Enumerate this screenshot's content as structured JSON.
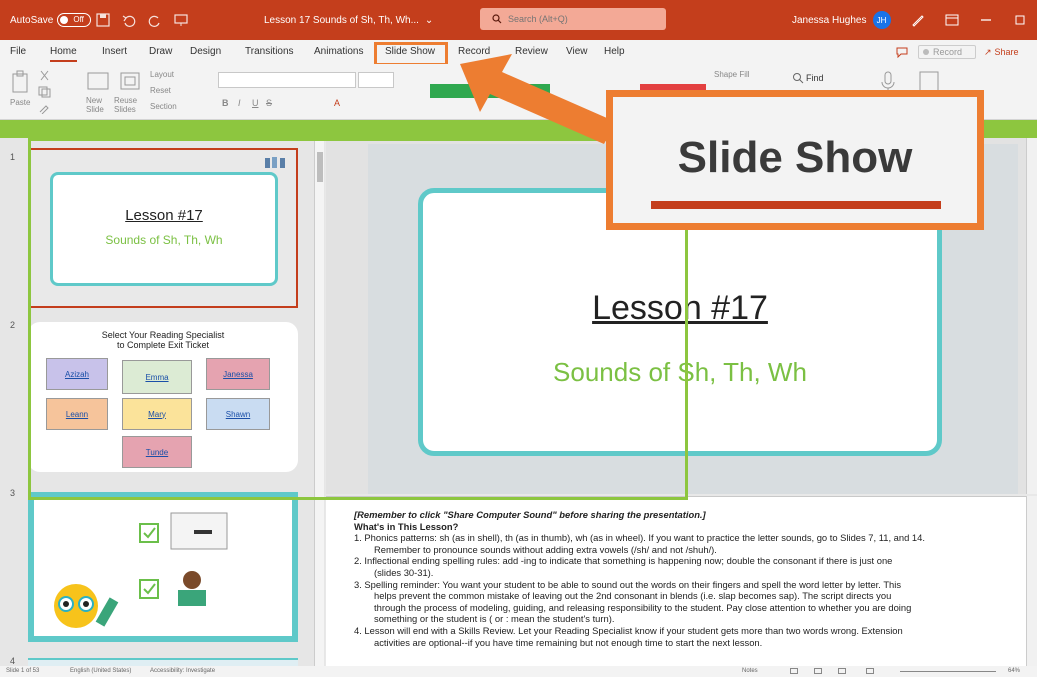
{
  "titlebar": {
    "autosave_label": "AutoSave",
    "autosave_state": "Off",
    "doc_title": "Lesson 17 Sounds of Sh, Th, Wh...",
    "search_placeholder": "Search (Alt+Q)",
    "user_name": "Janessa Hughes",
    "user_initials": "JH"
  },
  "menu": {
    "tabs": [
      "File",
      "Home",
      "Insert",
      "Draw",
      "Design",
      "Transitions",
      "Animations",
      "Slide Show",
      "Record",
      "Review",
      "View",
      "Help"
    ],
    "active_tab": "Home",
    "highlighted_tab": "Slide Show",
    "record_label": "Record",
    "share_label": "Share"
  },
  "ribbon": {
    "paste_label": "Paste",
    "new_slide_label": "New Slide",
    "reuse_slides_label": "Reuse Slides",
    "layout_label": "Layout",
    "reset_label": "Reset",
    "section_label": "Section",
    "find_label": "Find",
    "shape_fill_label": "Shape Fill"
  },
  "thumbnails": {
    "numbers": [
      "1",
      "2",
      "3",
      "4"
    ],
    "slide1_title": "Lesson #17",
    "slide1_subtitle": "Sounds of Sh, Th, Wh",
    "slide2_heading_line1": "Select Your Reading Specialist",
    "slide2_heading_line2": "to Complete Exit Ticket",
    "slide2_names": [
      "Azizah",
      "Emma",
      "Janessa",
      "Leann",
      "Mary",
      "Shawn",
      "Tunde"
    ]
  },
  "slide": {
    "title": "Lesson #17",
    "subtitle": "Sounds of Sh, Th, Wh"
  },
  "notes": {
    "line0": "[Remember to click \"Share Computer Sound\" before sharing the presentation.]",
    "line1": "What's in This Lesson?",
    "item1": "1. Phonics patterns: sh (as in shell), th (as in thumb), wh (as in wheel). If you want to practice the letter sounds, go to Slides 7, 11, and 14.",
    "item1b": "Remember to pronounce sounds without adding extra vowels (/sh/ and not /shuh/).",
    "item2": "2. Inflectional ending spelling rules: add -ing to indicate that something is happening now; double the consonant if there is just one",
    "item2b": "(slides 30-31).",
    "item3": "3. Spelling reminder: You want your student to be able to sound out the words on their fingers and spell the word letter by letter. This",
    "item3b": "helps prevent the common mistake of leaving out the 2nd consonant in blends (i.e. slap becomes sap). The script directs you",
    "item3c": "through the process of modeling, guiding, and releasing responsibility to the student. Pay close attention to whether you are doing",
    "item3d": "something or the student is (  or  : mean the student's turn).",
    "item4": "4. Lesson will end with a Skills Review. Let your Reading Specialist know if your student gets more than two words wrong. Extension",
    "item4b": "activities are optional--if you have time remaining but not enough time to start the next lesson."
  },
  "statusbar": {
    "slide_count": "Slide 1 of 53",
    "language": "English (United States)",
    "accessibility": "Accessibility: Investigate",
    "notes_label": "Notes",
    "zoom": "64%"
  },
  "callout": {
    "text": "Slide Show"
  },
  "colors": {
    "brand": "#c43e1c",
    "callout_border": "#ed7d31",
    "green_accent": "#8dc63f",
    "teal": "#5fc9c9"
  }
}
